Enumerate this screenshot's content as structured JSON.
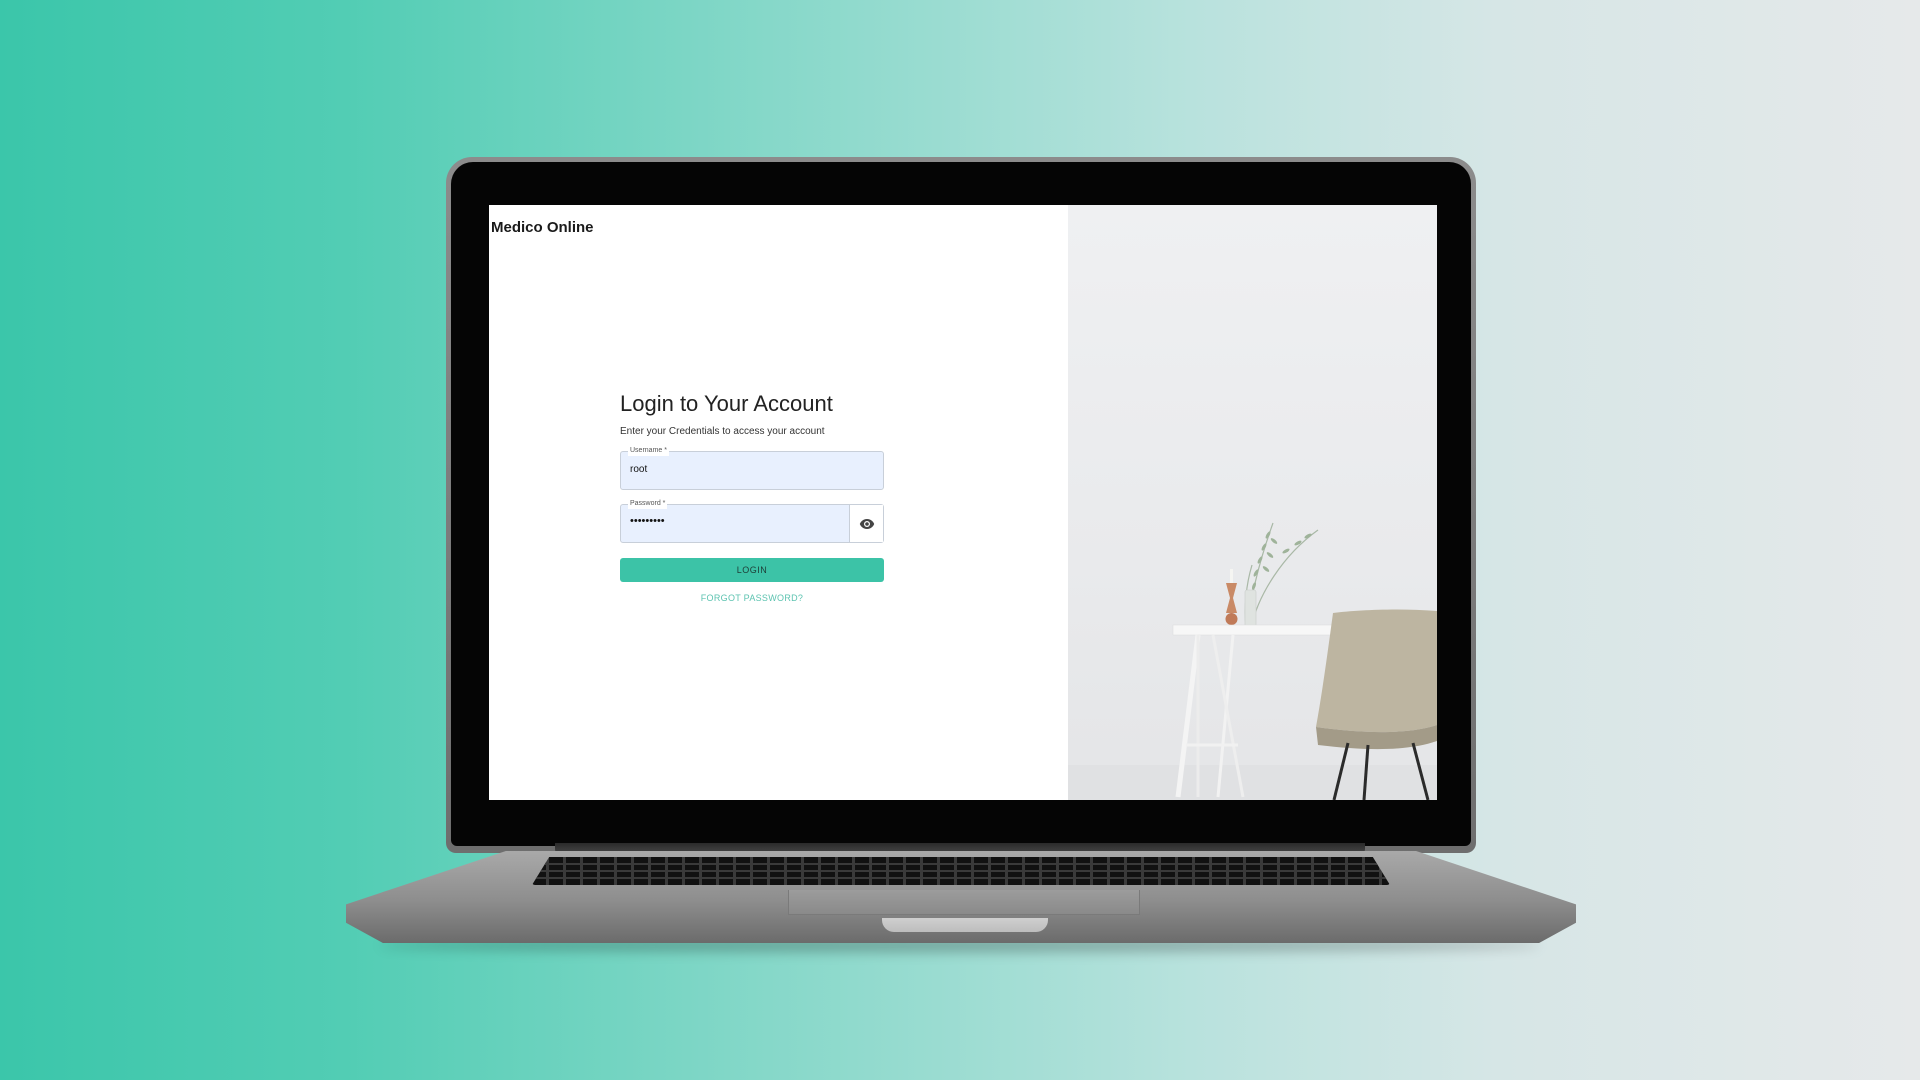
{
  "app": {
    "brand": "Medico Online"
  },
  "login": {
    "title": "Login to Your Account",
    "subtitle": "Enter your Credentials to access your account",
    "username": {
      "label": "Username *",
      "value": "root"
    },
    "password": {
      "label": "Password *",
      "value": "•••••••••",
      "toggle_icon": "eye-icon"
    },
    "submit_label": "LOGIN",
    "forgot_label": "FORGOT PASSWORD?"
  },
  "colors": {
    "accent": "#3cc3a7",
    "background_start": "#3bc6aa",
    "background_end": "#e6e9ea",
    "input_fill": "#e8f0fe"
  }
}
